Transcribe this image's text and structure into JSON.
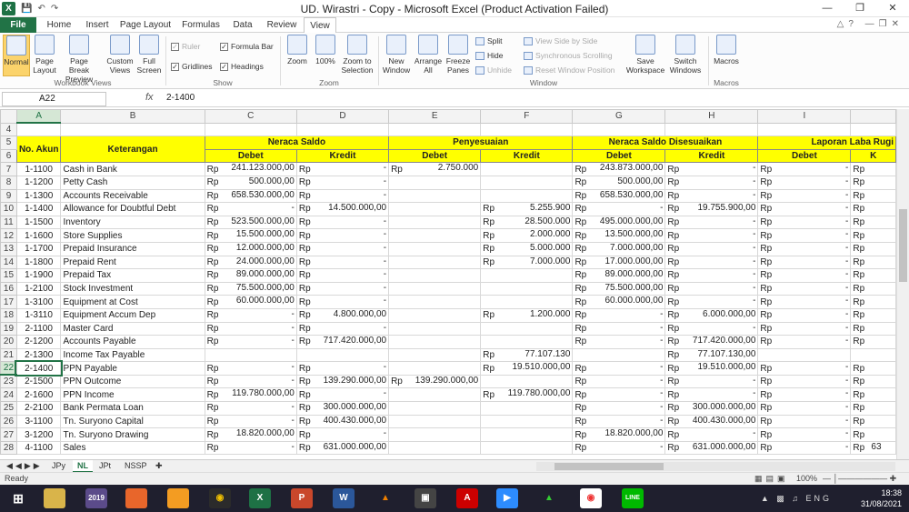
{
  "window": {
    "title": "UD. Wirastri - Copy - Microsoft Excel (Product Activation Failed)"
  },
  "ribbon_tabs": [
    "File",
    "Home",
    "Insert",
    "Page Layout",
    "Formulas",
    "Data",
    "Review",
    "View"
  ],
  "ribbon": {
    "normal": "Normal",
    "page_layout": "Page Layout",
    "page_break": "Page Break Preview",
    "custom_views": "Custom Views",
    "full_screen": "Full Screen",
    "ruler": "Ruler",
    "formula_bar": "Formula Bar",
    "gridlines": "Gridlines",
    "headings": "Headings",
    "zoom": "Zoom",
    "zoom100": "100%",
    "zoom_sel": "Zoom to Selection",
    "new_window": "New Window",
    "arrange_all": "Arrange All",
    "freeze": "Freeze Panes",
    "split": "Split",
    "hide": "Hide",
    "unhide": "Unhide",
    "side_by_side": "View Side by Side",
    "sync_scroll": "Synchronous Scrolling",
    "reset_pos": "Reset Window Position",
    "save_ws": "Save Workspace",
    "switch": "Switch Windows",
    "macros": "Macros",
    "groups": {
      "wb_views": "Workbook Views",
      "show": "Show",
      "zoom": "Zoom",
      "window": "Window",
      "macros": "Macros"
    }
  },
  "formula_bar": {
    "cell": "A22",
    "fx": "fx",
    "value": "2-1400"
  },
  "col_headers": [
    "A",
    "B",
    "C",
    "D",
    "E",
    "F",
    "G",
    "H",
    "I"
  ],
  "header": {
    "no_akun": "No. Akun",
    "keterangan": "Keterangan",
    "neraca_saldo": "Neraca Saldo",
    "penyesuaian": "Penyesuaian",
    "nsd": "Neraca Saldo Disesuaikan",
    "laba_rugi": "Laporan Laba Rugi",
    "debet": "Debet",
    "kredit": "Kredit",
    "k": "K"
  },
  "rows": [
    {
      "n": "7",
      "a": "1-1100",
      "b": "Cash in Bank",
      "c": "241.123.000,00",
      "d": "-",
      "e": "2.750.000",
      "f": "",
      "g": "243.873.000,00",
      "h": "-",
      "i": "-",
      "rp": [
        "c",
        "d",
        "e",
        "g",
        "h",
        "i",
        "j"
      ]
    },
    {
      "n": "8",
      "a": "1-1200",
      "b": "Petty Cash",
      "c": "500.000,00",
      "d": "-",
      "e": "",
      "f": "",
      "g": "500.000,00",
      "h": "-",
      "i": "-",
      "rp": [
        "c",
        "d",
        "g",
        "h",
        "i",
        "j"
      ]
    },
    {
      "n": "9",
      "a": "1-1300",
      "b": "Accounts Receivable",
      "c": "658.530.000,00",
      "d": "-",
      "e": "",
      "f": "",
      "g": "658.530.000,00",
      "h": "-",
      "i": "-",
      "rp": [
        "c",
        "d",
        "g",
        "h",
        "i",
        "j"
      ]
    },
    {
      "n": "10",
      "a": "1-1400",
      "b": "Allowance for Doubtful Debt",
      "c": "-",
      "d": "14.500.000,00",
      "e": "",
      "f": "5.255.900",
      "g": "-",
      "h": "19.755.900,00",
      "i": "-",
      "rp": [
        "c",
        "d",
        "f",
        "g",
        "h",
        "i",
        "j"
      ]
    },
    {
      "n": "11",
      "a": "1-1500",
      "b": "Inventory",
      "c": "523.500.000,00",
      "d": "-",
      "e": "",
      "f": "28.500.000",
      "g": "495.000.000,00",
      "h": "-",
      "i": "-",
      "rp": [
        "c",
        "d",
        "f",
        "g",
        "h",
        "i",
        "j"
      ]
    },
    {
      "n": "12",
      "a": "1-1600",
      "b": "Store Supplies",
      "c": "15.500.000,00",
      "d": "-",
      "e": "",
      "f": "2.000.000",
      "g": "13.500.000,00",
      "h": "-",
      "i": "-",
      "rp": [
        "c",
        "d",
        "f",
        "g",
        "h",
        "i",
        "j"
      ]
    },
    {
      "n": "13",
      "a": "1-1700",
      "b": "Prepaid Insurance",
      "c": "12.000.000,00",
      "d": "-",
      "e": "",
      "f": "5.000.000",
      "g": "7.000.000,00",
      "h": "-",
      "i": "-",
      "rp": [
        "c",
        "d",
        "f",
        "g",
        "h",
        "i",
        "j"
      ]
    },
    {
      "n": "14",
      "a": "1-1800",
      "b": "Prepaid Rent",
      "c": "24.000.000,00",
      "d": "-",
      "e": "",
      "f": "7.000.000",
      "g": "17.000.000,00",
      "h": "-",
      "i": "-",
      "rp": [
        "c",
        "d",
        "f",
        "g",
        "h",
        "i",
        "j"
      ]
    },
    {
      "n": "15",
      "a": "1-1900",
      "b": "Prepaid Tax",
      "c": "89.000.000,00",
      "d": "-",
      "e": "",
      "f": "",
      "g": "89.000.000,00",
      "h": "-",
      "i": "-",
      "rp": [
        "c",
        "d",
        "g",
        "h",
        "i",
        "j"
      ]
    },
    {
      "n": "16",
      "a": "1-2100",
      "b": "Stock Investment",
      "c": "75.500.000,00",
      "d": "-",
      "e": "",
      "f": "",
      "g": "75.500.000,00",
      "h": "-",
      "i": "-",
      "rp": [
        "c",
        "d",
        "g",
        "h",
        "i",
        "j"
      ]
    },
    {
      "n": "17",
      "a": "1-3100",
      "b": "Equipment at Cost",
      "c": "60.000.000,00",
      "d": "-",
      "e": "",
      "f": "",
      "g": "60.000.000,00",
      "h": "-",
      "i": "-",
      "rp": [
        "c",
        "d",
        "g",
        "h",
        "i",
        "j"
      ]
    },
    {
      "n": "18",
      "a": "1-3110",
      "b": "Equipment Accum Dep",
      "c": "-",
      "d": "4.800.000,00",
      "e": "",
      "f": "1.200.000",
      "g": "-",
      "h": "6.000.000,00",
      "i": "-",
      "rp": [
        "c",
        "d",
        "f",
        "g",
        "h",
        "i",
        "j"
      ]
    },
    {
      "n": "19",
      "a": "2-1100",
      "b": "Master Card",
      "c": "-",
      "d": "-",
      "e": "",
      "f": "",
      "g": "-",
      "h": "-",
      "i": "-",
      "rp": [
        "c",
        "d",
        "g",
        "h",
        "i",
        "j"
      ]
    },
    {
      "n": "20",
      "a": "2-1200",
      "b": "Accounts Payable",
      "c": "-",
      "d": "717.420.000,00",
      "e": "",
      "f": "",
      "g": "-",
      "h": "717.420.000,00",
      "i": "-",
      "rp": [
        "c",
        "d",
        "g",
        "h",
        "i",
        "j"
      ]
    },
    {
      "n": "21",
      "a": "2-1300",
      "b": "Income Tax Payable",
      "c": "",
      "d": "",
      "e": "",
      "f": "77.107.130",
      "g": "",
      "h": "77.107.130,00",
      "i": "",
      "rp": [
        "f",
        "h"
      ]
    },
    {
      "n": "22",
      "a": "2-1400",
      "b": "PPN Payable",
      "c": "-",
      "d": "-",
      "e": "",
      "f": "19.510.000,00",
      "g": "-",
      "h": "19.510.000,00",
      "i": "-",
      "rp": [
        "c",
        "d",
        "f",
        "g",
        "h",
        "i",
        "j"
      ]
    },
    {
      "n": "23",
      "a": "2-1500",
      "b": "PPN Outcome",
      "c": "-",
      "d": "139.290.000,00",
      "e": "139.290.000,00",
      "f": "",
      "g": "-",
      "h": "-",
      "i": "-",
      "rp": [
        "c",
        "d",
        "e",
        "g",
        "h",
        "i",
        "j"
      ]
    },
    {
      "n": "24",
      "a": "2-1600",
      "b": "PPN Income",
      "c": "119.780.000,00",
      "d": "-",
      "e": "",
      "f": "119.780.000,00",
      "g": "-",
      "h": "-",
      "i": "-",
      "rp": [
        "c",
        "d",
        "f",
        "g",
        "h",
        "i",
        "j"
      ]
    },
    {
      "n": "25",
      "a": "2-2100",
      "b": "Bank Permata Loan",
      "c": "-",
      "d": "300.000.000,00",
      "e": "",
      "f": "",
      "g": "-",
      "h": "300.000.000,00",
      "i": "-",
      "rp": [
        "c",
        "d",
        "g",
        "h",
        "i",
        "j"
      ]
    },
    {
      "n": "26",
      "a": "3-1100",
      "b": "Tn. Suryono Capital",
      "c": "-",
      "d": "400.430.000,00",
      "e": "",
      "f": "",
      "g": "-",
      "h": "400.430.000,00",
      "i": "-",
      "rp": [
        "c",
        "d",
        "g",
        "h",
        "i",
        "j"
      ]
    },
    {
      "n": "27",
      "a": "3-1200",
      "b": "Tn. Suryono Drawing",
      "c": "18.820.000,00",
      "d": "-",
      "e": "",
      "f": "",
      "g": "18.820.000,00",
      "h": "-",
      "i": "-",
      "rp": [
        "c",
        "d",
        "g",
        "h",
        "i",
        "j"
      ]
    },
    {
      "n": "28",
      "a": "4-1100",
      "b": "Sales",
      "c": "-",
      "d": "631.000.000,00",
      "e": "",
      "f": "",
      "g": "-",
      "h": "631.000.000,00",
      "i": "-",
      "j": "63",
      "rp": [
        "c",
        "d",
        "g",
        "h",
        "i",
        "j"
      ]
    }
  ],
  "sheet_tabs": [
    "JPy",
    "NL",
    "JPt",
    "NSSP"
  ],
  "active_sheet": "NL",
  "status": {
    "ready": "Ready",
    "zoom": "100%"
  },
  "taskbar": {
    "time": "18:38",
    "date": "31/08/2021",
    "lang": "ENG"
  }
}
